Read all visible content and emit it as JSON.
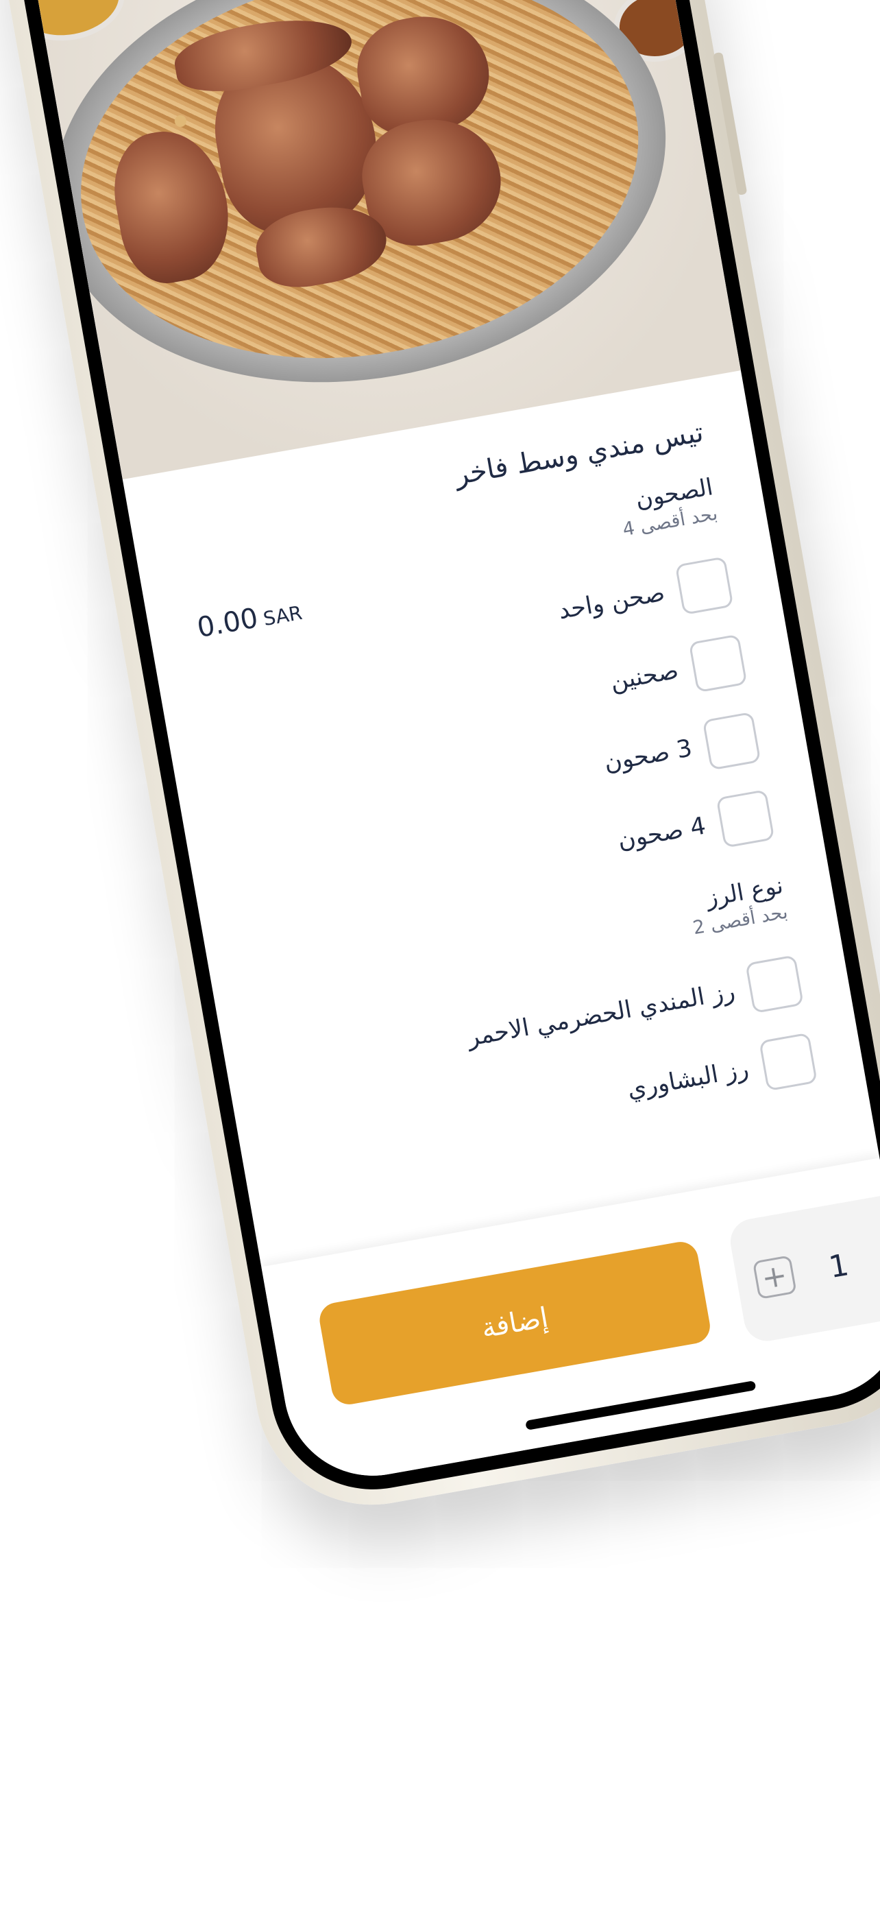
{
  "product": {
    "title": "تيس مندي وسط فاخر",
    "price_value": "0.00",
    "currency": "SAR"
  },
  "groups": [
    {
      "name": "الصحون",
      "max_label": "بحد أقصى 4",
      "options": [
        "صحن واحد",
        "صحنين",
        "3 صحون",
        "4 صحون"
      ]
    },
    {
      "name": "نوع الرز",
      "max_label": "بحد أقصى 2",
      "options": [
        "رز المندي الحضرمي الاحمر",
        "رز البشاوري"
      ]
    }
  ],
  "cart": {
    "add_label": "إضافة",
    "quantity": "1",
    "increment_icon": "plus-icon",
    "decrement_icon": "minus-icon"
  },
  "colors": {
    "header": "#c48f25",
    "accent": "#e6a12b",
    "text": "#1f2a44"
  }
}
